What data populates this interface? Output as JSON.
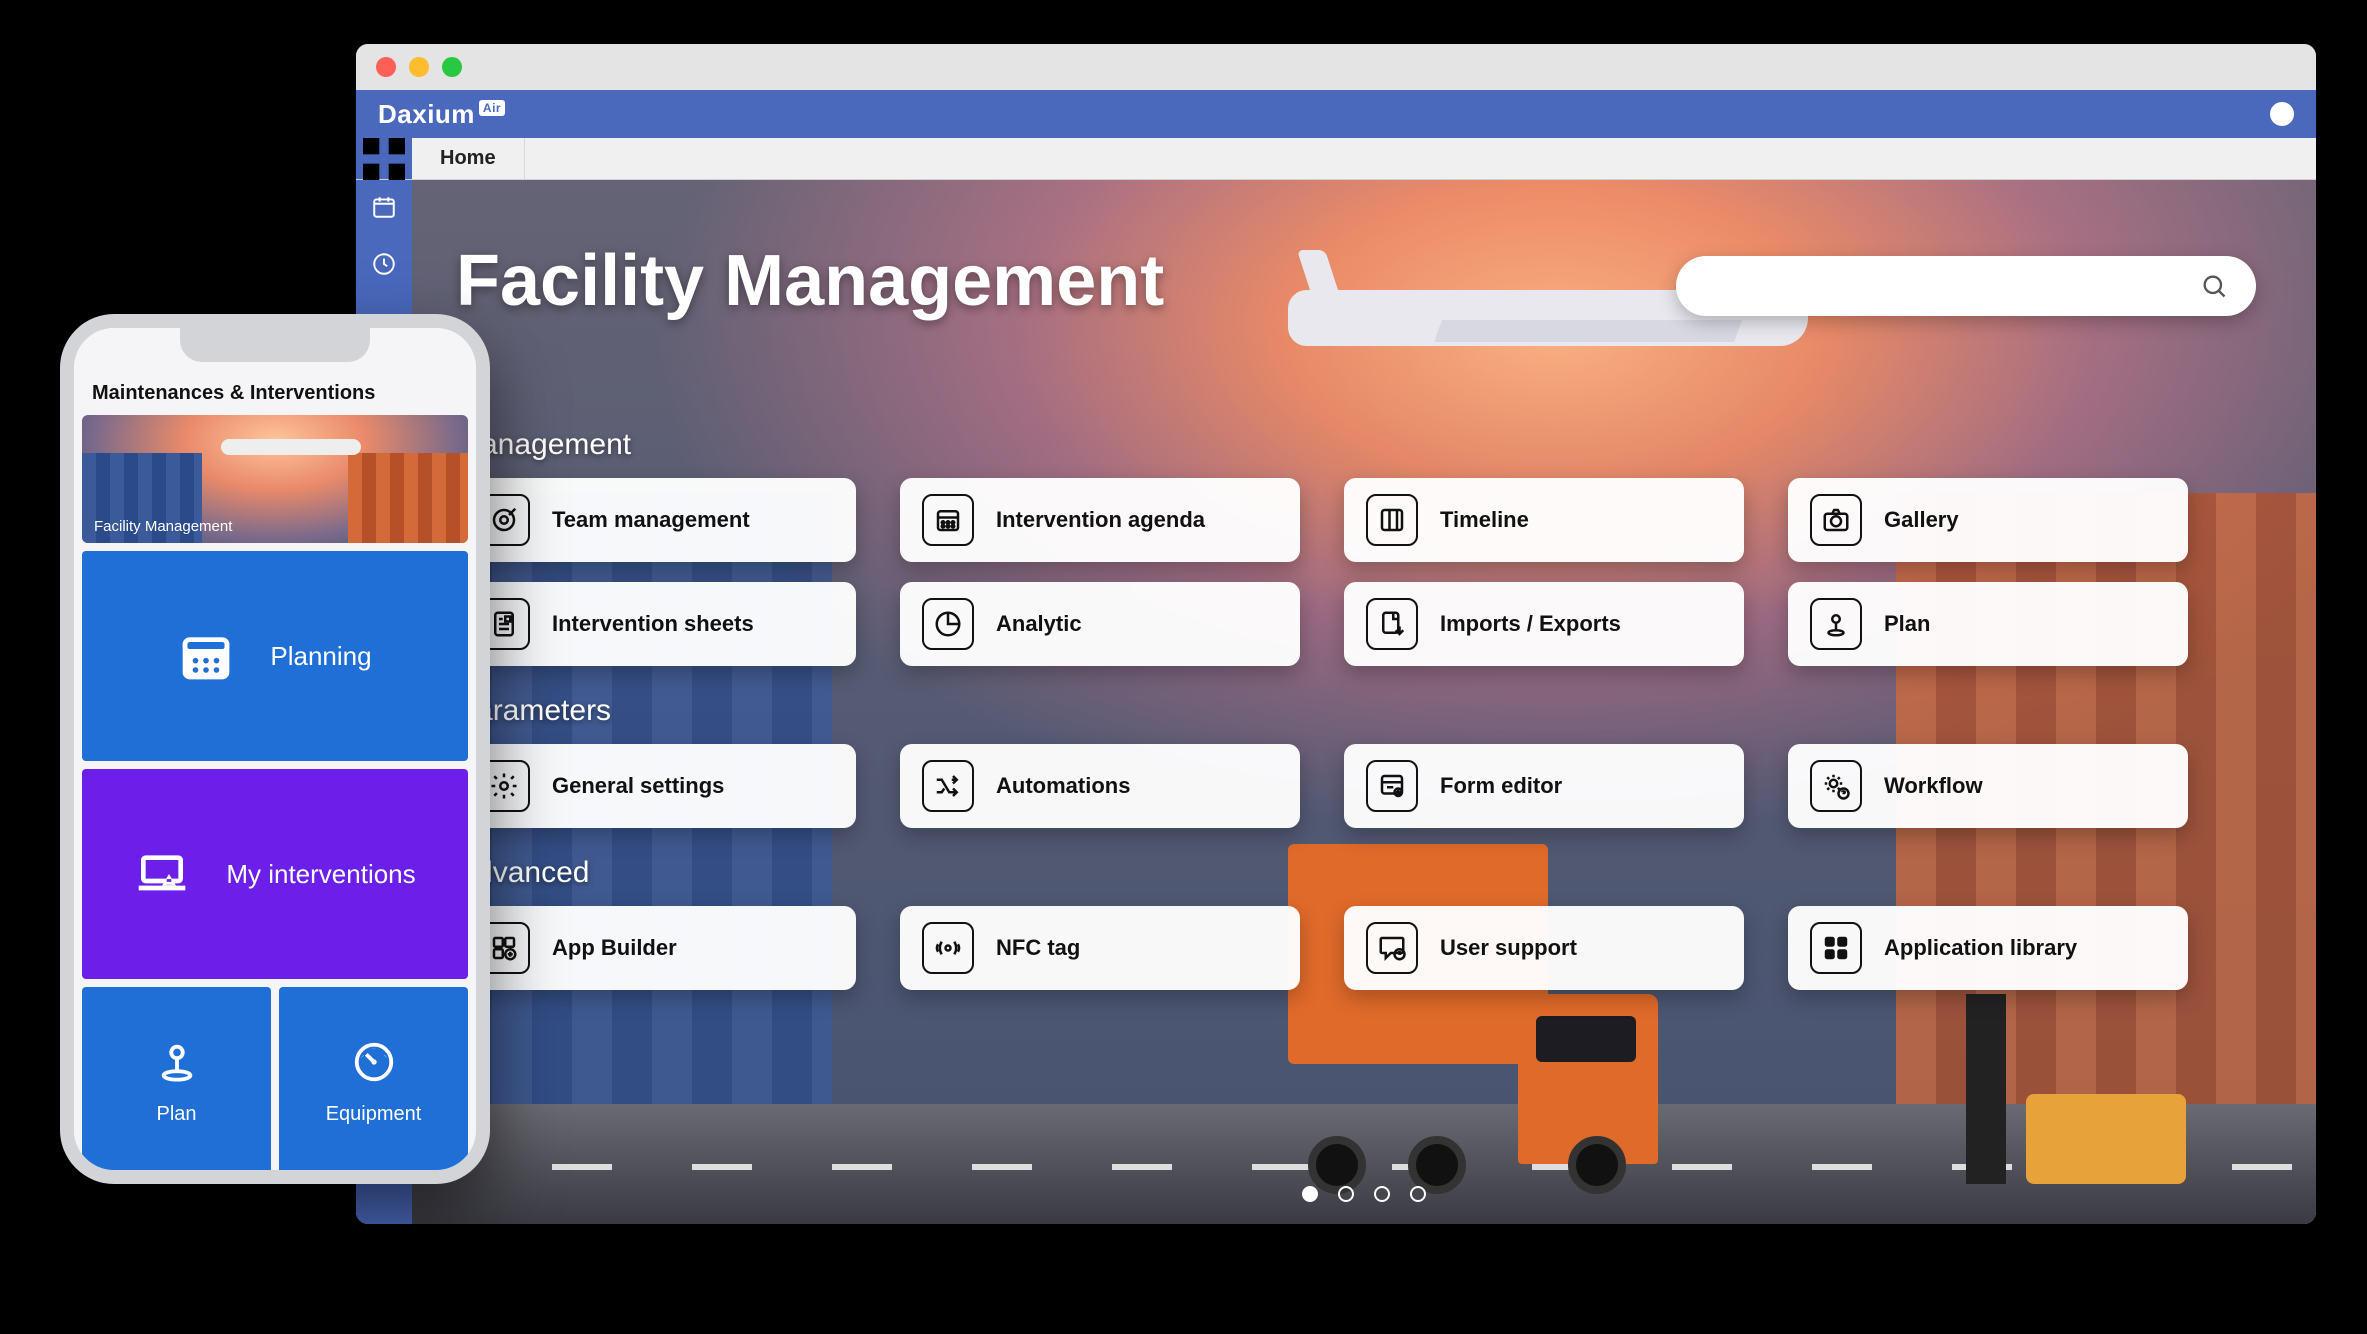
{
  "desktop": {
    "brand": "Daxium",
    "brand_badge": "Air",
    "breadcrumb": {
      "home": "Home"
    },
    "hero_title": "Facility Management",
    "sections": {
      "management": {
        "title": "Management",
        "row1": {
          "team": "Team management",
          "agenda": "Intervention agenda",
          "timeline": "Timeline",
          "gallery": "Gallery"
        },
        "row2": {
          "sheets": "Intervention sheets",
          "analytic": "Analytic",
          "imports": "Imports / Exports",
          "plan": "Plan"
        }
      },
      "parameters": {
        "title": "Parameters",
        "row": {
          "general": "General settings",
          "automations": "Automations",
          "formeditor": "Form editor",
          "workflow": "Workflow"
        }
      },
      "advanced": {
        "title": "Advanced",
        "row": {
          "appbuilder": "App Builder",
          "nfc": "NFC tag",
          "support": "User support",
          "library": "Application library"
        }
      }
    },
    "pager": {
      "count": 4,
      "active": 0
    }
  },
  "phone": {
    "title": "Maintenances & Interventions",
    "banner_caption": "Facility Management",
    "tiles": {
      "planning": "Planning",
      "interventions": "My interventions",
      "plan": "Plan",
      "equipment": "Equipment"
    }
  }
}
